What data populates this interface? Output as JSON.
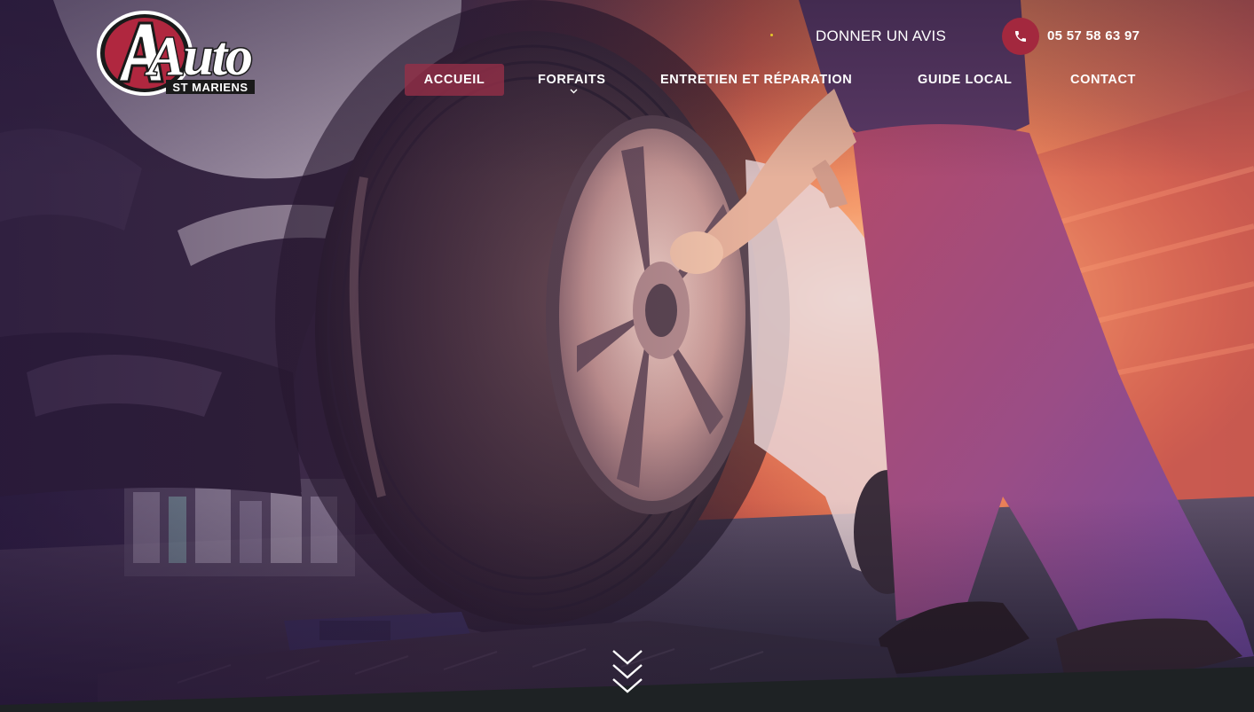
{
  "site": {
    "logo_text": "Auto",
    "logo_subtext": "ST MARIENS",
    "brand_color": "#a3283e"
  },
  "topbar": {
    "review_label": "DONNER UN AVIS",
    "phone_number": "05 57 58 63 97",
    "phone_icon": "phone-icon"
  },
  "nav": {
    "items": [
      {
        "label": "ACCUEIL",
        "active": true
      },
      {
        "label": "FORFAITS",
        "has_dropdown": true
      },
      {
        "label": "ENTRETIEN ET RÉPARATION"
      },
      {
        "label": "GUIDE LOCAL"
      },
      {
        "label": "CONTACT"
      }
    ]
  },
  "hero": {
    "scroll_icon": "triple-chevron-down-icon"
  }
}
